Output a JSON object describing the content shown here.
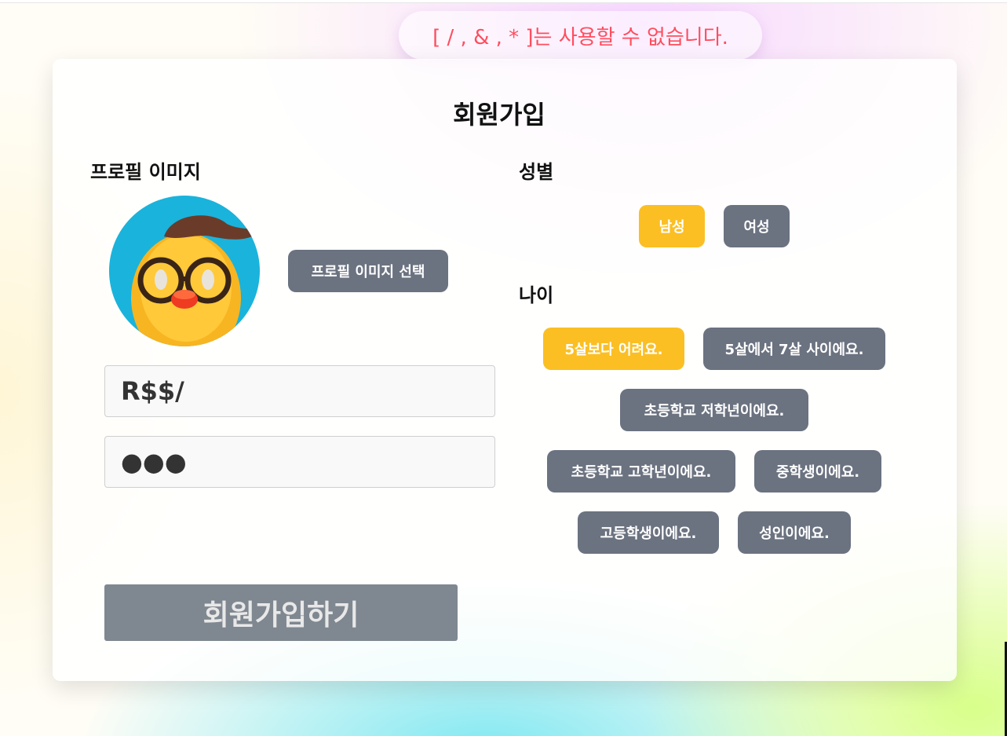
{
  "warning": "[ / , & , * ]는 사용할 수 없습니다.",
  "signup": {
    "title": "회원가입",
    "profile_label": "프로필 이미지",
    "select_image_button": "프로필 이미지 선택",
    "nickname_value": "R$$/",
    "password_value": "●●●",
    "submit_button": "회원가입하기"
  },
  "gender": {
    "label": "성별",
    "options": [
      "남성",
      "여성"
    ],
    "selected": "남성"
  },
  "age": {
    "label": "나이",
    "options": [
      "5살보다 어려요.",
      "5살에서 7살 사이에요.",
      "초등학교 저학년이에요.",
      "초등학교 고학년이에요.",
      "중학생이에요.",
      "고등학생이에요.",
      "성인이에요."
    ],
    "selected": "5살보다 어려요."
  },
  "colors": {
    "selected": "#fbbf24",
    "unselected": "#6b7280",
    "warning_text": "#ff4d5e",
    "submit_disabled": "#7f8790"
  },
  "icons": {
    "avatar": "duck-avatar-with-glasses"
  }
}
